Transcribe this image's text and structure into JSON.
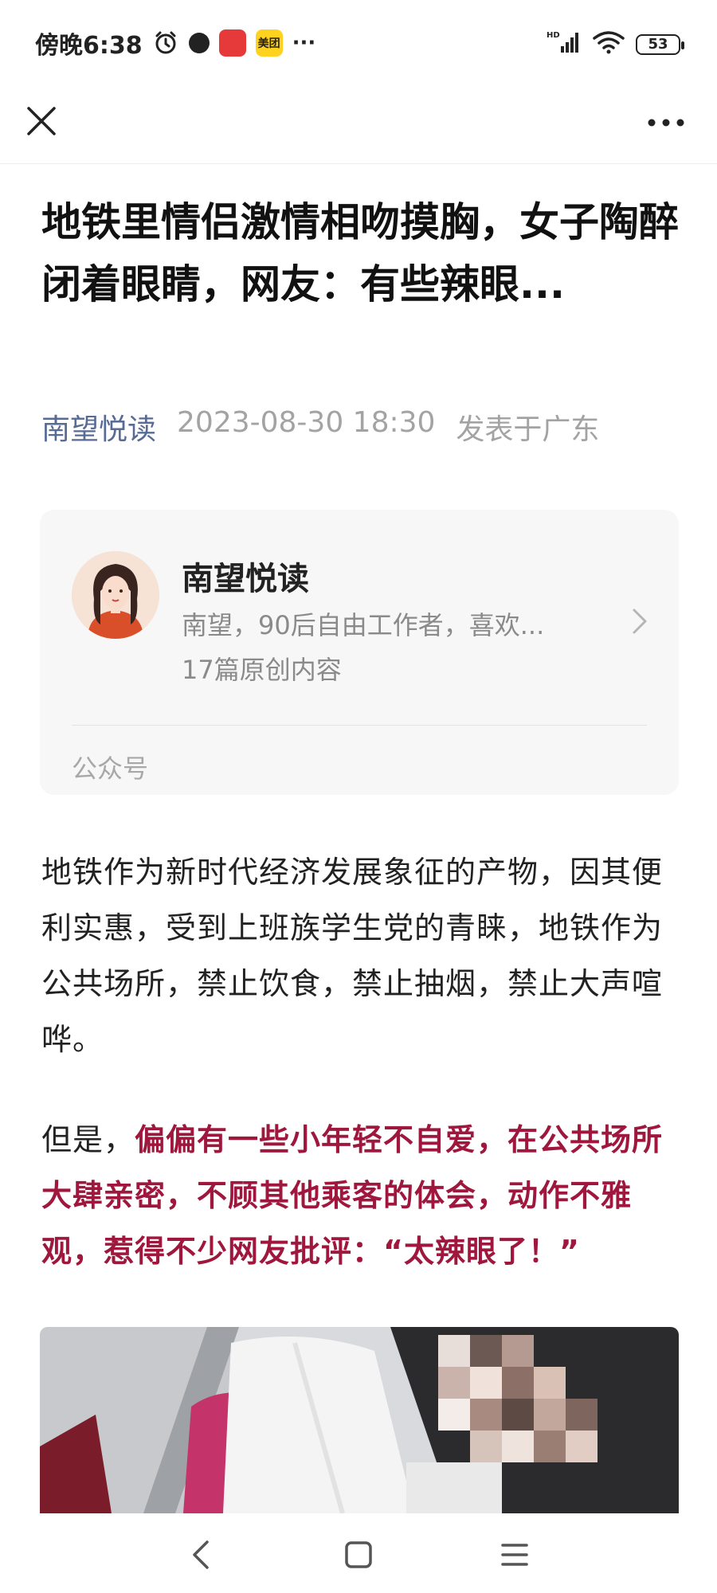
{
  "status_bar": {
    "time": "傍晚6:38",
    "app_badge_1": "",
    "app_badge_2": "美团",
    "more": "···",
    "network": "HD",
    "battery": "53",
    "icons": [
      "alarm-icon",
      "dark-app-icon",
      "red-app-icon",
      "meituan-icon",
      "signal-icon",
      "wifi-icon",
      "battery-icon"
    ]
  },
  "nav": {
    "icons": [
      "close-icon",
      "more-icon"
    ]
  },
  "article": {
    "title": "地铁里情侣激情相吻摸胸，女子陶醉闭着眼睛，网友：有些辣眼...",
    "author": "南望悦读",
    "datetime": "2023-08-30 18:30",
    "location": "发表于广东"
  },
  "account_card": {
    "name": "南望悦读",
    "description": "南望，90后自由工作者，喜欢...",
    "count": "17篇原创内容",
    "type": "公众号",
    "icons": [
      "avatar",
      "chevron-right-icon"
    ]
  },
  "body": {
    "para1": "地铁作为新时代经济发展象征的产物，因其便利实惠，受到上班族学生党的青睐，地铁作为公共场所，禁止饮食，禁止抽烟，禁止大声喧哗。",
    "para2_prefix": "但是，",
    "para2_highlight": "偏偏有一些小年轻不自爱，在公共场所大肆亲密，不顾其他乘客的体会，动作不雅观，惹得不少网友批评：“太辣眼了！”"
  },
  "bottom_nav": {
    "icons": [
      "back-icon",
      "home-icon",
      "menu-icon"
    ]
  },
  "colors": {
    "link_blue": "#576b95",
    "highlight_red": "#a0173e",
    "meta_gray": "#a3a3a3",
    "card_bg": "#f7f7f7"
  }
}
